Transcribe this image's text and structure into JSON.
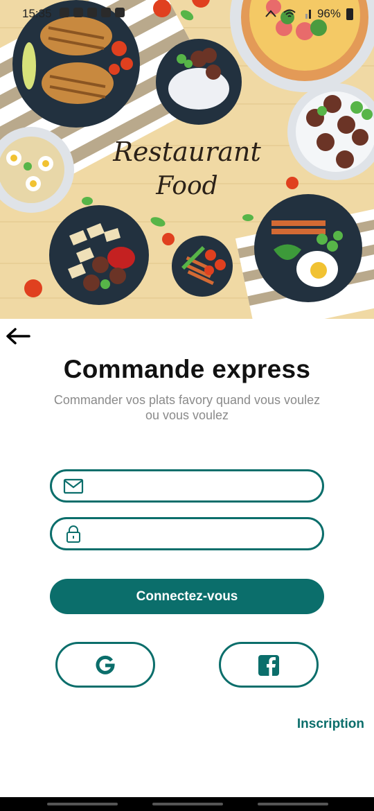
{
  "status": {
    "time": "15:35",
    "battery": "96%"
  },
  "hero": {
    "script_line1": "Restaurant",
    "script_line2": "Food"
  },
  "page": {
    "title": "Commande express",
    "subtitle": "Commander vos plats favory quand vous voulez ou vous voulez"
  },
  "form": {
    "email_value": "",
    "password_value": "",
    "login_label": "Connectez-vous"
  },
  "links": {
    "signup_label": "Inscription"
  },
  "colors": {
    "accent": "#0b6e6b",
    "wood": "#f0d9a4"
  },
  "icons": [
    "back-arrow-icon",
    "mail-icon",
    "lock-icon",
    "google-icon",
    "facebook-icon"
  ]
}
